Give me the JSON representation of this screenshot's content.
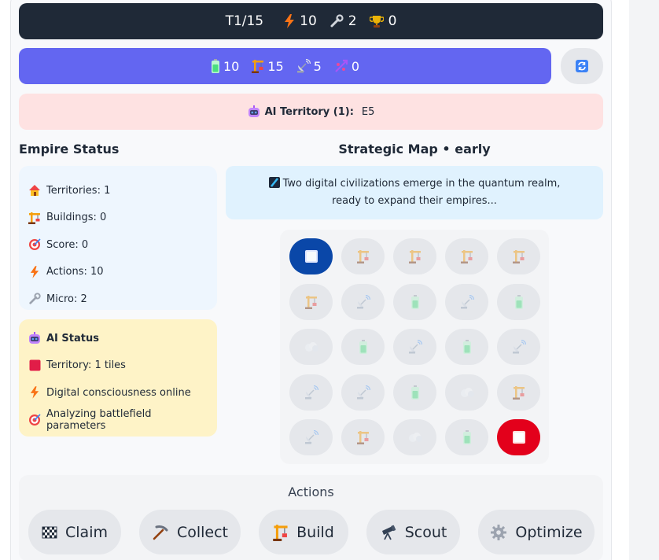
{
  "header": {
    "turn": "T1/15",
    "actions_value": "10",
    "micro_value": "2",
    "score_value": "0"
  },
  "resources": {
    "energy": "10",
    "buildings": "15",
    "satellites": "5",
    "links": "0"
  },
  "ai_territory": {
    "label": "AI Territory (1):",
    "tiles": "E5"
  },
  "empire": {
    "title": "Empire Status",
    "territories": "Territories: 1",
    "buildings": "Buildings: 0",
    "score": "Score: 0",
    "actions": "Actions: 10",
    "micro": "Micro: 2"
  },
  "ai_status": {
    "title": "AI Status",
    "territory": "Territory: 1 tiles",
    "line1": "Digital consciousness online",
    "line2": "Analyzing battlefield parameters"
  },
  "map": {
    "title": "Strategic Map • early",
    "message": "Two digital civilizations emerge in the quantum realm, ready to expand their empires...",
    "tiles": [
      [
        "player",
        "crane",
        "crane",
        "crane",
        "crane"
      ],
      [
        "crane",
        "satellite",
        "battery",
        "satellite",
        "battery"
      ],
      [
        "cloud",
        "battery",
        "satellite",
        "battery",
        "satellite"
      ],
      [
        "satellite",
        "satellite",
        "battery",
        "cloud",
        "crane"
      ],
      [
        "satellite",
        "crane",
        "cloud",
        "battery",
        "ai"
      ]
    ]
  },
  "actions": {
    "title": "Actions",
    "buttons": [
      {
        "label": "Claim",
        "icon": "checkered-flag-icon"
      },
      {
        "label": "Collect",
        "icon": "pickaxe-icon"
      },
      {
        "label": "Build",
        "icon": "construction-crane-icon"
      },
      {
        "label": "Scout",
        "icon": "telescope-icon"
      },
      {
        "label": "Optimize",
        "icon": "gear-icon"
      }
    ]
  },
  "colors": {
    "header_bg": "#1f2937",
    "resource_bg": "#6366f1",
    "ai_territory_bg": "#fee2e2",
    "empire_bg": "#eef6fe",
    "ai_status_bg": "#fef3c7",
    "message_bg": "#e0f2fe",
    "player_tile": "#0a47a8",
    "ai_tile": "#e3001b"
  }
}
